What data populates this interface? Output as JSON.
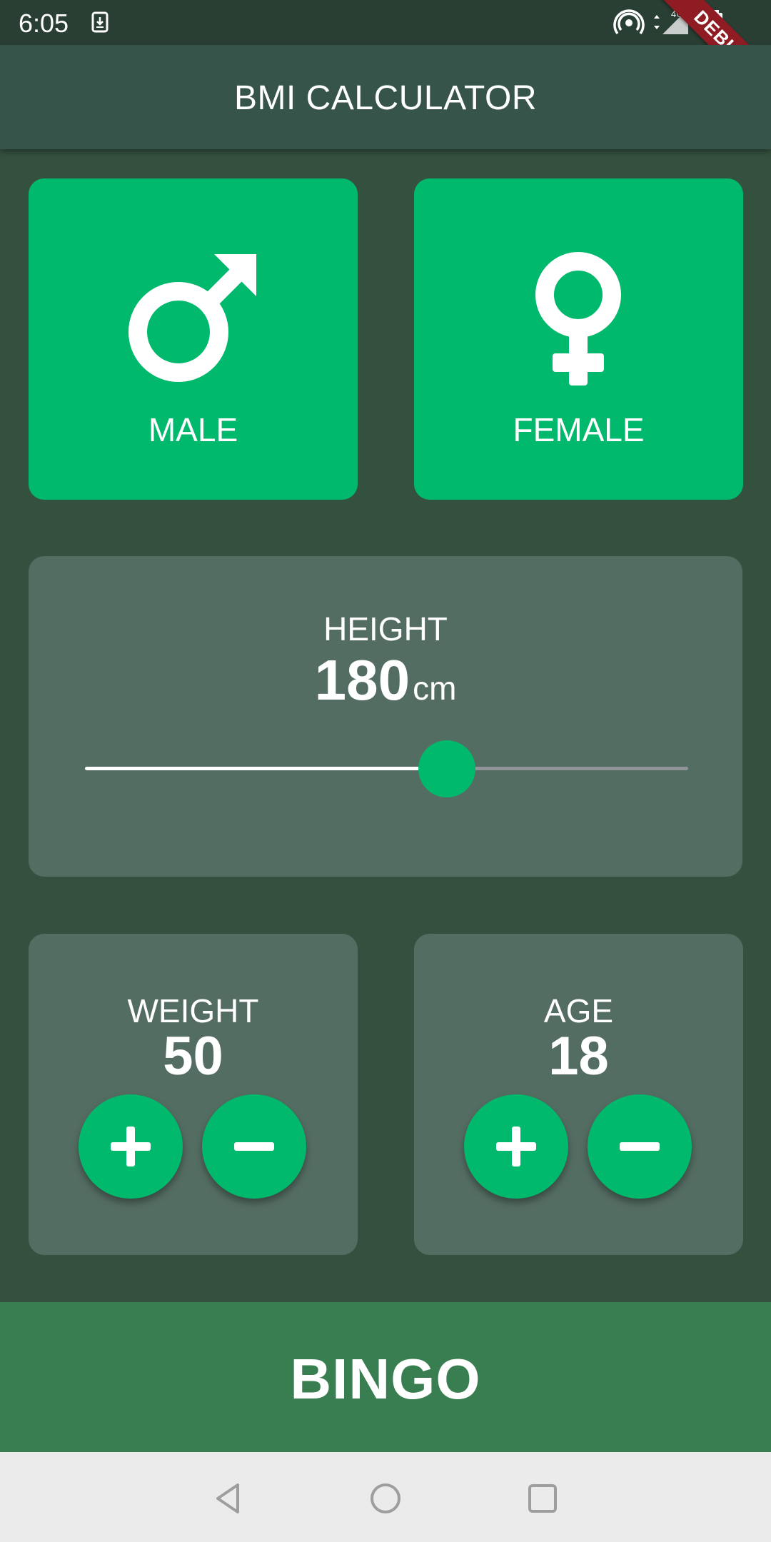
{
  "status_bar": {
    "time": "6:05",
    "icons": [
      "download-icon",
      "hotspot-icon",
      "data-arrows-icon",
      "signal-icon",
      "battery-charging-icon"
    ],
    "network_label": "4G"
  },
  "debug_banner": "DEBUG",
  "app_bar": {
    "title": "BMI CALCULATOR"
  },
  "gender": {
    "male_label": "MALE",
    "female_label": "FEMALE",
    "male_icon": "male-symbol-icon",
    "female_icon": "female-symbol-icon"
  },
  "height": {
    "label": "HEIGHT",
    "value": "180",
    "unit": "cm",
    "slider_fraction": 0.6
  },
  "weight": {
    "label": "WEIGHT",
    "value": "50"
  },
  "age": {
    "label": "AGE",
    "value": "18"
  },
  "bingo_button": {
    "label": "BINGO"
  },
  "nav_bar": {
    "icons": [
      "back-icon",
      "home-icon",
      "recents-icon"
    ]
  },
  "colors": {
    "background": "#34513F",
    "accent": "#00B96C",
    "panel": "#546D62",
    "bottom_button": "#397E50",
    "debug_ribbon": "#8F1C23"
  }
}
